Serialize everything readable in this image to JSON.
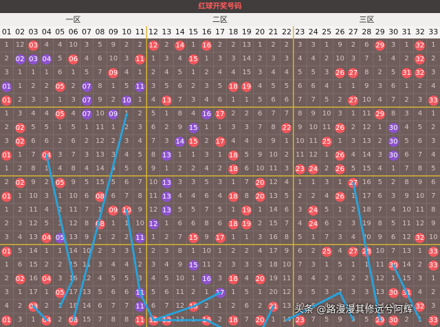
{
  "title": "红球开奖号码",
  "zones": [
    "一区",
    "二区",
    "三区"
  ],
  "columns": [
    "01",
    "02",
    "03",
    "04",
    "05",
    "06",
    "07",
    "08",
    "09",
    "10",
    "11",
    "12",
    "13",
    "14",
    "15",
    "16",
    "17",
    "18",
    "19",
    "20",
    "21",
    "22",
    "23",
    "24",
    "25",
    "26",
    "27",
    "28",
    "29",
    "30",
    "31",
    "32",
    "33"
  ],
  "rows": [
    {
      "cells": [
        "1",
        "12",
        "03",
        "4",
        "4",
        "10",
        "3",
        "5",
        "9",
        "2",
        "2",
        "12",
        "2",
        "14",
        "1",
        "16",
        "2",
        "2",
        "13",
        "1",
        "2",
        "2",
        "3",
        "3",
        "1",
        "9",
        "2",
        "6",
        "29",
        "3",
        "1",
        "32",
        "1"
      ],
      "balls": {
        "3": "red",
        "12": "red",
        "14": "red",
        "16": "red",
        "29": "red",
        "32": "red"
      }
    },
    {
      "cells": [
        "2",
        "02",
        "03",
        "04",
        "5",
        "06",
        "4",
        "6",
        "10",
        "3",
        "11",
        "1",
        "3",
        "4",
        "15",
        "1",
        "3",
        "3",
        "14",
        "2",
        "3",
        "3",
        "4",
        "4",
        "2",
        "10",
        "3",
        "7",
        "1",
        "4",
        "2",
        "32",
        "2"
      ],
      "balls": {
        "2": "purple",
        "3": "purple",
        "4": "purple",
        "6": "red",
        "11": "red",
        "15": "red",
        "32": "red"
      }
    },
    {
      "cells": [
        "3",
        "1",
        "1",
        "1",
        "6",
        "1",
        "5",
        "7",
        "09",
        "4",
        "1",
        "2",
        "4",
        "5",
        "1",
        "2",
        "4",
        "4",
        "15",
        "3",
        "4",
        "4",
        "5",
        "5",
        "3",
        "26",
        "27",
        "8",
        "2",
        "5",
        "31",
        "32",
        "3"
      ],
      "balls": {
        "9": "red",
        "26": "red",
        "27": "red",
        "31": "red",
        "32": "red"
      }
    },
    {
      "cells": [
        "01",
        "1",
        "2",
        "2",
        "05",
        "2",
        "07",
        "8",
        "1",
        "5",
        "11",
        "3",
        "5",
        "6",
        "2",
        "3",
        "5",
        "18",
        "19",
        "4",
        "5",
        "5",
        "6",
        "6",
        "4",
        "1",
        "1",
        "9",
        "3",
        "6",
        "1",
        "2",
        "4"
      ],
      "balls": {
        "1": "purple",
        "5": "red",
        "7": "purple",
        "11": "purple",
        "18": "red",
        "19": "red"
      }
    },
    {
      "cells": [
        "01",
        "2",
        "3",
        "3",
        "1",
        "3",
        "07",
        "9",
        "2",
        "10",
        "1",
        "4",
        "13",
        "7",
        "3",
        "4",
        "6",
        "1",
        "1",
        "5",
        "6",
        "6",
        "7",
        "7",
        "5",
        "2",
        "27",
        "10",
        "4",
        "7",
        "2",
        "3",
        "33"
      ],
      "balls": {
        "1": "red",
        "7": "purple",
        "10": "purple",
        "13": "red",
        "27": "red",
        "33": "red"
      }
    },
    {
      "cells": [
        "1",
        "3",
        "4",
        "4",
        "05",
        "4",
        "07",
        "10",
        "09",
        "1",
        "2",
        "5",
        "1",
        "8",
        "4",
        "16",
        "17",
        "2",
        "2",
        "6",
        "7",
        "7",
        "8",
        "9",
        "10",
        "3",
        "1",
        "11",
        "29",
        "8",
        "3",
        "4",
        "1"
      ],
      "balls": {
        "5": "red",
        "7": "purple",
        "9": "purple",
        "16": "purple",
        "17": "red",
        "29": "red"
      }
    },
    {
      "cells": [
        "2",
        "02",
        "5",
        "5",
        "1",
        "5",
        "1",
        "11",
        "1",
        "2",
        "3",
        "6",
        "2",
        "9",
        "15",
        "1",
        "1",
        "3",
        "3",
        "7",
        "8",
        "22",
        "9",
        "10",
        "11",
        "26",
        "2",
        "12",
        "1",
        "30",
        "4",
        "5",
        "2"
      ],
      "balls": {
        "2": "red",
        "15": "purple",
        "22": "red",
        "26": "red",
        "30": "purple"
      }
    },
    {
      "cells": [
        "3",
        "02",
        "6",
        "6",
        "2",
        "6",
        "2",
        "12",
        "2",
        "3",
        "4",
        "7",
        "3",
        "14",
        "15",
        "2",
        "17",
        "4",
        "4",
        "8",
        "9",
        "1",
        "10",
        "11",
        "25",
        "1",
        "3",
        "13",
        "2",
        "30",
        "5",
        "6",
        "3"
      ],
      "balls": {
        "2": "red",
        "14": "purple",
        "15": "red",
        "17": "red",
        "25": "red",
        "30": "purple"
      }
    },
    {
      "cells": [
        "01",
        "1",
        "7",
        "04",
        "3",
        "7",
        "3",
        "13",
        "3",
        "4",
        "5",
        "8",
        "13",
        "1",
        "1",
        "3",
        "1",
        "18",
        "5",
        "9",
        "10",
        "2",
        "11",
        "12",
        "1",
        "26",
        "4",
        "14",
        "3",
        "30",
        "6",
        "7",
        "4"
      ],
      "balls": {
        "1": "red",
        "4": "red",
        "13": "purple",
        "18": "red",
        "26": "red",
        "30": "purple"
      }
    },
    {
      "cells": [
        "1",
        "2",
        "8",
        "1",
        "4",
        "8",
        "4",
        "14",
        "4",
        "5",
        "6",
        "9",
        "1",
        "2",
        "2",
        "4",
        "2",
        "18",
        "6",
        "10",
        "11",
        "3",
        "23",
        "24",
        "2",
        "26",
        "5",
        "15",
        "4",
        "1",
        "7",
        "8",
        "5"
      ],
      "balls": {
        "18": "red",
        "23": "red",
        "24": "red",
        "26": "red"
      }
    },
    {
      "cells": [
        "2",
        "02",
        "9",
        "2",
        "05",
        "9",
        "5",
        "15",
        "5",
        "6",
        "7",
        "10",
        "13",
        "3",
        "3",
        "5",
        "3",
        "1",
        "7",
        "20",
        "12",
        "4",
        "1",
        "1",
        "3",
        "1",
        "27",
        "16",
        "5",
        "2",
        "8",
        "9",
        "6"
      ],
      "balls": {
        "2": "red",
        "5": "red",
        "13": "purple",
        "20": "red",
        "27": "red"
      }
    },
    {
      "cells": [
        "01",
        "1",
        "10",
        "3",
        "1",
        "10",
        "6",
        "08",
        "6",
        "7",
        "8",
        "11",
        "13",
        "4",
        "4",
        "6",
        "4",
        "18",
        "8",
        "20",
        "13",
        "5",
        "2",
        "2",
        "4",
        "26",
        "1",
        "17",
        "6",
        "3",
        "9",
        "10",
        "7"
      ],
      "balls": {
        "1": "red",
        "8": "red",
        "13": "purple",
        "18": "red",
        "20": "red",
        "26": "red"
      }
    },
    {
      "cells": [
        "1",
        "2",
        "11",
        "4",
        "2",
        "11",
        "7",
        "1",
        "09",
        "10",
        "9",
        "12",
        "13",
        "5",
        "5",
        "7",
        "5",
        "1",
        "19",
        "1",
        "14",
        "6",
        "3",
        "24",
        "5",
        "1",
        "2",
        "18",
        "7",
        "4",
        "10",
        "11",
        "8"
      ],
      "balls": {
        "9": "red",
        "10": "red",
        "13": "purple",
        "19": "red",
        "24": "red"
      }
    },
    {
      "cells": [
        "2",
        "3",
        "12",
        "5",
        "3",
        "12",
        "8",
        "08",
        "1",
        "1",
        "10",
        "12",
        "1",
        "6",
        "6",
        "8",
        "6",
        "18",
        "19",
        "2",
        "15",
        "7",
        "4",
        "24",
        "6",
        "2",
        "3",
        "19",
        "8",
        "5",
        "11",
        "12",
        "9"
      ],
      "balls": {
        "8": "red",
        "12": "purple",
        "18": "red",
        "19": "red",
        "24": "red"
      }
    },
    {
      "cells": [
        "3",
        "4",
        "13",
        "04",
        "05",
        "13",
        "9",
        "1",
        "2",
        "2",
        "11",
        "1",
        "2",
        "7",
        "15",
        "9",
        "17",
        "1",
        "1",
        "3",
        "16",
        "8",
        "5",
        "1",
        "7",
        "3",
        "4",
        "20",
        "9",
        "6",
        "12",
        "32",
        "10"
      ],
      "balls": {
        "4": "red",
        "5": "purple",
        "11": "purple",
        "15": "red",
        "17": "red",
        "32": "red"
      }
    },
    {
      "cells": [
        "01",
        "5",
        "14",
        "1",
        "1",
        "14",
        "10",
        "2",
        "3",
        "3",
        "1",
        "2",
        "3",
        "8",
        "1",
        "10",
        "1",
        "2",
        "2",
        "4",
        "17",
        "9",
        "6",
        "2",
        "25",
        "4",
        "27",
        "28",
        "10",
        "7",
        "13",
        "1",
        "33"
      ],
      "balls": {
        "1": "red",
        "25": "red",
        "27": "red",
        "28": "red",
        "33": "red"
      }
    },
    {
      "cells": [
        "1",
        "6",
        "15",
        "2",
        "2",
        "15",
        "11",
        "3",
        "4",
        "4",
        "2",
        "3",
        "4",
        "9",
        "15",
        "11",
        "2",
        "3",
        "3",
        "5",
        "18",
        "10",
        "7",
        "3",
        "1",
        "5",
        "1",
        "1",
        "11",
        "30",
        "14",
        "2",
        "33"
      ],
      "balls": {
        "15": "purple",
        "30": "red",
        "33": "red"
      }
    },
    {
      "cells": [
        "2",
        "02",
        "16",
        "04",
        "3",
        "16",
        "12",
        "4",
        "5",
        "5",
        "3",
        "4",
        "5",
        "10",
        "1",
        "16",
        "3",
        "18",
        "4",
        "20",
        "19",
        "11",
        "8",
        "4",
        "2",
        "6",
        "2",
        "2",
        "12",
        "1",
        "15",
        "3",
        "1"
      ],
      "balls": {
        "2": "red",
        "4": "red",
        "16": "purple",
        "18": "red",
        "20": "red"
      }
    },
    {
      "cells": [
        "3",
        "1",
        "17",
        "1",
        "05",
        "17",
        "13",
        "5",
        "6",
        "6",
        "11",
        "5",
        "6",
        "11",
        "2",
        "1",
        "17",
        "1",
        "5",
        "1",
        "20",
        "12",
        "9",
        "5",
        "3",
        "7",
        "3",
        "3",
        "13",
        "30",
        "31",
        "4",
        "2"
      ],
      "balls": {
        "5": "red",
        "11": "purple",
        "17": "purple",
        "30": "red",
        "31": "red"
      }
    },
    {
      "cells": [
        "4",
        "2",
        "03",
        "2",
        "1",
        "18",
        "14",
        "6",
        "7",
        "7",
        "11",
        "6",
        "7",
        "12",
        "15",
        "2",
        "1",
        "2",
        "6",
        "2",
        "21",
        "13",
        "10",
        "6",
        "4",
        "8",
        "4",
        "4",
        "14",
        "1",
        "1",
        "32",
        "3"
      ],
      "balls": {
        "3": "red",
        "11": "purple",
        "15": "red",
        "21": "red",
        "32": "red"
      }
    },
    {
      "cells": [
        "01",
        "3",
        "1",
        "04",
        "2",
        "06",
        "15",
        "7",
        "8",
        "8",
        "11",
        "12",
        "13",
        "13",
        "1",
        "16",
        "2",
        "18",
        "7",
        "20",
        "1",
        "14",
        "23",
        "7",
        "5",
        "9",
        "5",
        "5",
        "29",
        "30",
        "2",
        "1",
        "33"
      ],
      "balls": {
        "1": "red",
        "4": "red",
        "6": "red",
        "11": "red",
        "12": "red",
        "13": "red",
        "16": "red",
        "18": "red",
        "20": "red",
        "23": "red",
        "29": "red",
        "30": "red",
        "33": "red"
      }
    }
  ],
  "trend_lines": [
    [
      [
        4,
        8
      ],
      [
        6,
        17
      ],
      [
        5,
        19
      ]
    ],
    [
      [
        6,
        20
      ],
      [
        10,
        5
      ]
    ],
    [
      [
        3,
        19
      ],
      [
        4,
        20
      ]
    ],
    [
      [
        10,
        12
      ],
      [
        11,
        18
      ],
      [
        12,
        20
      ],
      [
        15,
        19
      ],
      [
        17,
        18
      ]
    ],
    [
      [
        12,
        20
      ],
      [
        13,
        20
      ],
      [
        15,
        20
      ],
      [
        16,
        20
      ],
      [
        18,
        21
      ],
      [
        20,
        21
      ],
      [
        21,
        19
      ]
    ],
    [
      [
        22,
        20
      ],
      [
        24,
        19
      ],
      [
        26,
        18
      ],
      [
        27,
        20
      ]
    ],
    [
      [
        27,
        10
      ],
      [
        29,
        20
      ]
    ],
    [
      [
        30,
        16
      ],
      [
        32,
        20
      ]
    ]
  ],
  "watermark": "头条 @路漫漫其修远兮阿辉",
  "colors": {
    "red": "#f2575c",
    "purple": "#8d52ce",
    "line": "#28a3dc",
    "zone_divider": "#d7b534"
  }
}
